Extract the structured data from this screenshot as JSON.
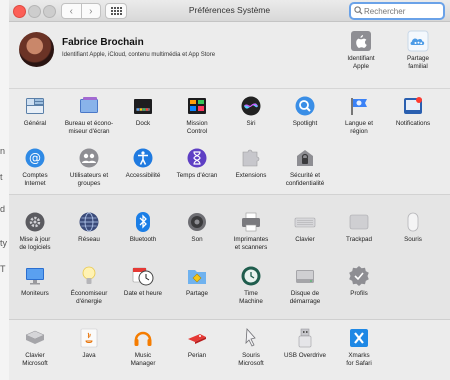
{
  "window": {
    "title": "Préférences Système",
    "search_placeholder": "Rechercher"
  },
  "background_window": {
    "fragments": [
      "n",
      "t",
      "d",
      "ty",
      "T"
    ]
  },
  "account": {
    "name": "Fabrice Brochain",
    "subtitle": "Identifiant Apple, iCloud, contenu multimédia et App Store",
    "items": [
      {
        "label": "Identifiant\nApple",
        "icon": "apple-id-icon"
      },
      {
        "label": "Partage\nfamilial",
        "icon": "family-sharing-icon"
      }
    ]
  },
  "row1": [
    {
      "label": "Général",
      "icon": "general-icon"
    },
    {
      "label": "Bureau et écono-\nmiseur d'écran",
      "icon": "desktop-screensaver-icon"
    },
    {
      "label": "Dock",
      "icon": "dock-icon"
    },
    {
      "label": "Mission\nControl",
      "icon": "mission-control-icon"
    },
    {
      "label": "Siri",
      "icon": "siri-icon"
    },
    {
      "label": "Spotlight",
      "icon": "spotlight-icon"
    },
    {
      "label": "Langue et\nrégion",
      "icon": "language-region-icon"
    },
    {
      "label": "Notifications",
      "icon": "notifications-icon"
    }
  ],
  "row2": [
    {
      "label": "Comptes\nInternet",
      "icon": "internet-accounts-icon"
    },
    {
      "label": "Utilisateurs et\ngroupes",
      "icon": "users-groups-icon"
    },
    {
      "label": "Accessibilité",
      "icon": "accessibility-icon"
    },
    {
      "label": "Temps d'écran",
      "icon": "screen-time-icon"
    },
    {
      "label": "Extensions",
      "icon": "extensions-icon"
    },
    {
      "label": "Sécurité et\nconfidentialité",
      "icon": "security-privacy-icon"
    }
  ],
  "row3": [
    {
      "label": "Mise à jour\nde logiciels",
      "icon": "software-update-icon"
    },
    {
      "label": "Réseau",
      "icon": "network-icon"
    },
    {
      "label": "Bluetooth",
      "icon": "bluetooth-icon"
    },
    {
      "label": "Son",
      "icon": "sound-icon"
    },
    {
      "label": "Imprimantes\net scanners",
      "icon": "printers-scanners-icon"
    },
    {
      "label": "Clavier",
      "icon": "keyboard-icon"
    },
    {
      "label": "Trackpad",
      "icon": "trackpad-icon"
    },
    {
      "label": "Souris",
      "icon": "mouse-icon"
    }
  ],
  "row4": [
    {
      "label": "Moniteurs",
      "icon": "displays-icon"
    },
    {
      "label": "Économiseur\nd'énergie",
      "icon": "energy-saver-icon"
    },
    {
      "label": "Date et heure",
      "icon": "date-time-icon"
    },
    {
      "label": "Partage",
      "icon": "sharing-icon"
    },
    {
      "label": "Time\nMachine",
      "icon": "time-machine-icon"
    },
    {
      "label": "Disque de\ndémarrage",
      "icon": "startup-disk-icon"
    },
    {
      "label": "Profils",
      "icon": "profiles-icon"
    }
  ],
  "row5": [
    {
      "label": "Clavier\nMicrosoft",
      "icon": "microsoft-keyboard-icon"
    },
    {
      "label": "Java",
      "icon": "java-icon"
    },
    {
      "label": "Music\nManager",
      "icon": "music-manager-icon"
    },
    {
      "label": "Perian",
      "icon": "perian-icon"
    },
    {
      "label": "Souris\nMicrosoft",
      "icon": "microsoft-mouse-icon"
    },
    {
      "label": "USB Overdrive",
      "icon": "usb-overdrive-icon"
    },
    {
      "label": "Xmarks\nfor Safari",
      "icon": "xmarks-icon"
    }
  ]
}
